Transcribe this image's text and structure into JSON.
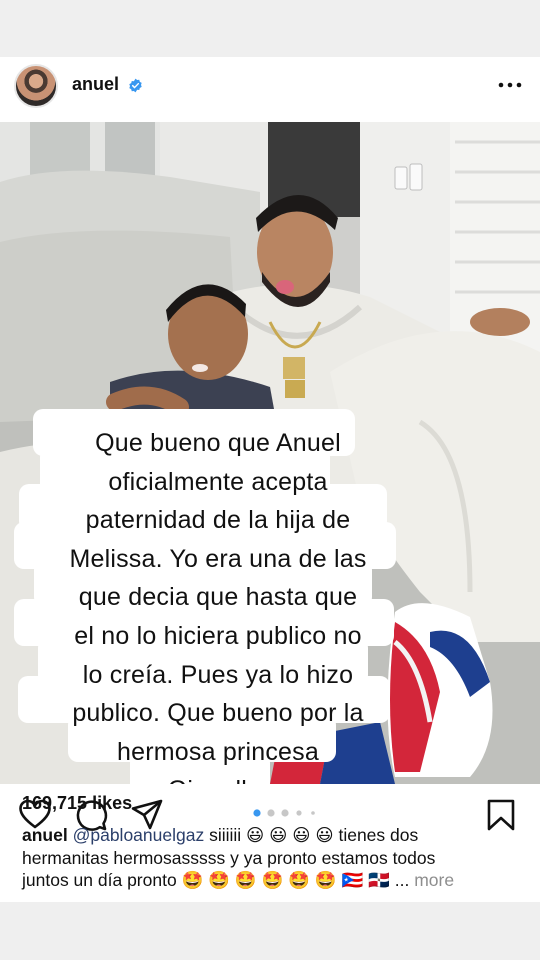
{
  "post": {
    "username": "anuel",
    "verified": true,
    "overlay_lines": [
      "Que bueno que Anuel",
      "oficialmente acepta",
      "paternidad de la hija de",
      "Melissa. Yo era una de las",
      "que decia que hasta que",
      "el no lo hiciera publico no",
      "lo creía. Pues ya lo hizo",
      "publico. Que bueno por la",
      "hermosa princesa",
      "Gianella."
    ],
    "carousel": {
      "current": 1,
      "count": 5
    },
    "likes": "169,715 likes",
    "caption": {
      "username": "anuel",
      "mention": "@pabloanuelgaz",
      "part1": "siiiiii 😃 😃 😃 😃 tienes dos",
      "part2": "hermanitas hermosasssss y ya pronto estamos todos",
      "part3": "juntos un día pronto 🤩 🤩 🤩 🤩 🤩 🤩 🇵🇷 🇩🇴 ...",
      "more": "more"
    }
  },
  "icons": {
    "like": "heart-icon",
    "comment": "comment-icon",
    "share": "send-icon",
    "save": "bookmark-icon",
    "more": "more-icon",
    "verified": "verified-badge-icon"
  },
  "colors": {
    "verified_blue": "#3897f0",
    "dot_active": "#3897f0",
    "dot_inactive": "#c7c7c7"
  }
}
